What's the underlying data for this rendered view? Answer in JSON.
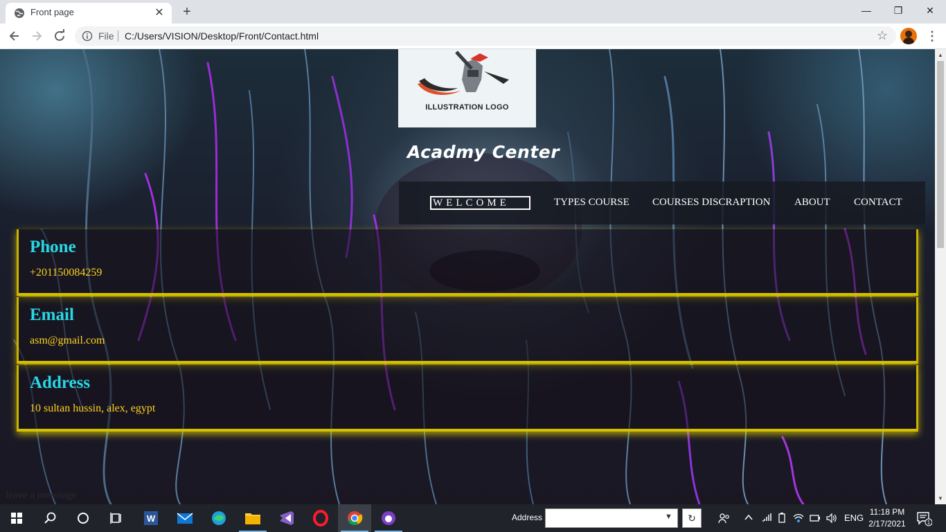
{
  "browser": {
    "tab_title": "Front page",
    "tab_close": "✕",
    "new_tab": "+",
    "scheme_label": "File",
    "url": "C:/Users/VISION/Desktop/Front/Contact.html",
    "window_controls": {
      "minimize": "—",
      "maximize": "❐",
      "close": "✕"
    }
  },
  "page": {
    "logo_text": "ILLUSTRATION LOGO",
    "site_title": "Acadmy Center",
    "nav": {
      "welcome": "WELCOME",
      "types_course": "TYPES COURSE",
      "courses_discraption": "COURSES DISCRAPTION",
      "about": "ABOUT",
      "contact": "CONTACT"
    },
    "contacts": [
      {
        "heading": "Phone",
        "value": "+201150084259"
      },
      {
        "heading": "Email",
        "value": "asm@gmail.com"
      },
      {
        "heading": "Address",
        "value": "10 sultan hussin, alex, egypt"
      }
    ],
    "leave_message": "leave a messsage",
    "colors": {
      "heading": "#27d8e6",
      "value": "#ffd21f",
      "card_border": "#d4c000"
    }
  },
  "taskbar": {
    "address_label": "Address",
    "address_value": "",
    "language": "ENG",
    "time": "11:18 PM",
    "date": "2/17/2021",
    "notification_count": "1",
    "pinned_apps": [
      "windows-start",
      "search",
      "cortana",
      "task-view",
      "word",
      "mail",
      "edge",
      "file-explorer",
      "visual-studio",
      "opera",
      "chrome",
      "screenshot-tool"
    ]
  }
}
